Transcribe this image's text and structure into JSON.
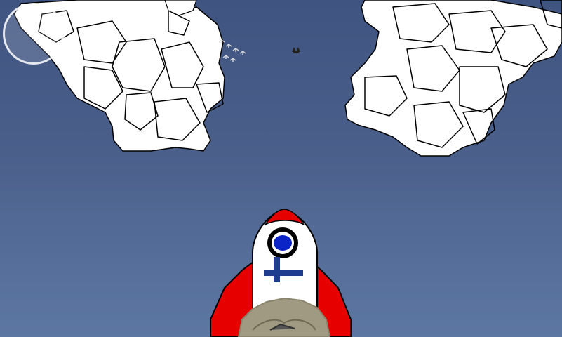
{
  "game": {
    "name": "",
    "scene": "rocket-launch-sky"
  },
  "colors": {
    "sky_top": "#3f5480",
    "sky_bottom": "#5c77a2",
    "cloud": "#ffffff",
    "rocket_body": "#ffffff",
    "rocket_fins": "#e60000",
    "window": "#0a24c8",
    "flag_cross": "#1e3d8f",
    "smoke": "#a09a82"
  },
  "icons": {
    "control_button": "circle-button-icon",
    "flag": "finnish-flag-icon",
    "birds": "bird-flock-icon"
  }
}
